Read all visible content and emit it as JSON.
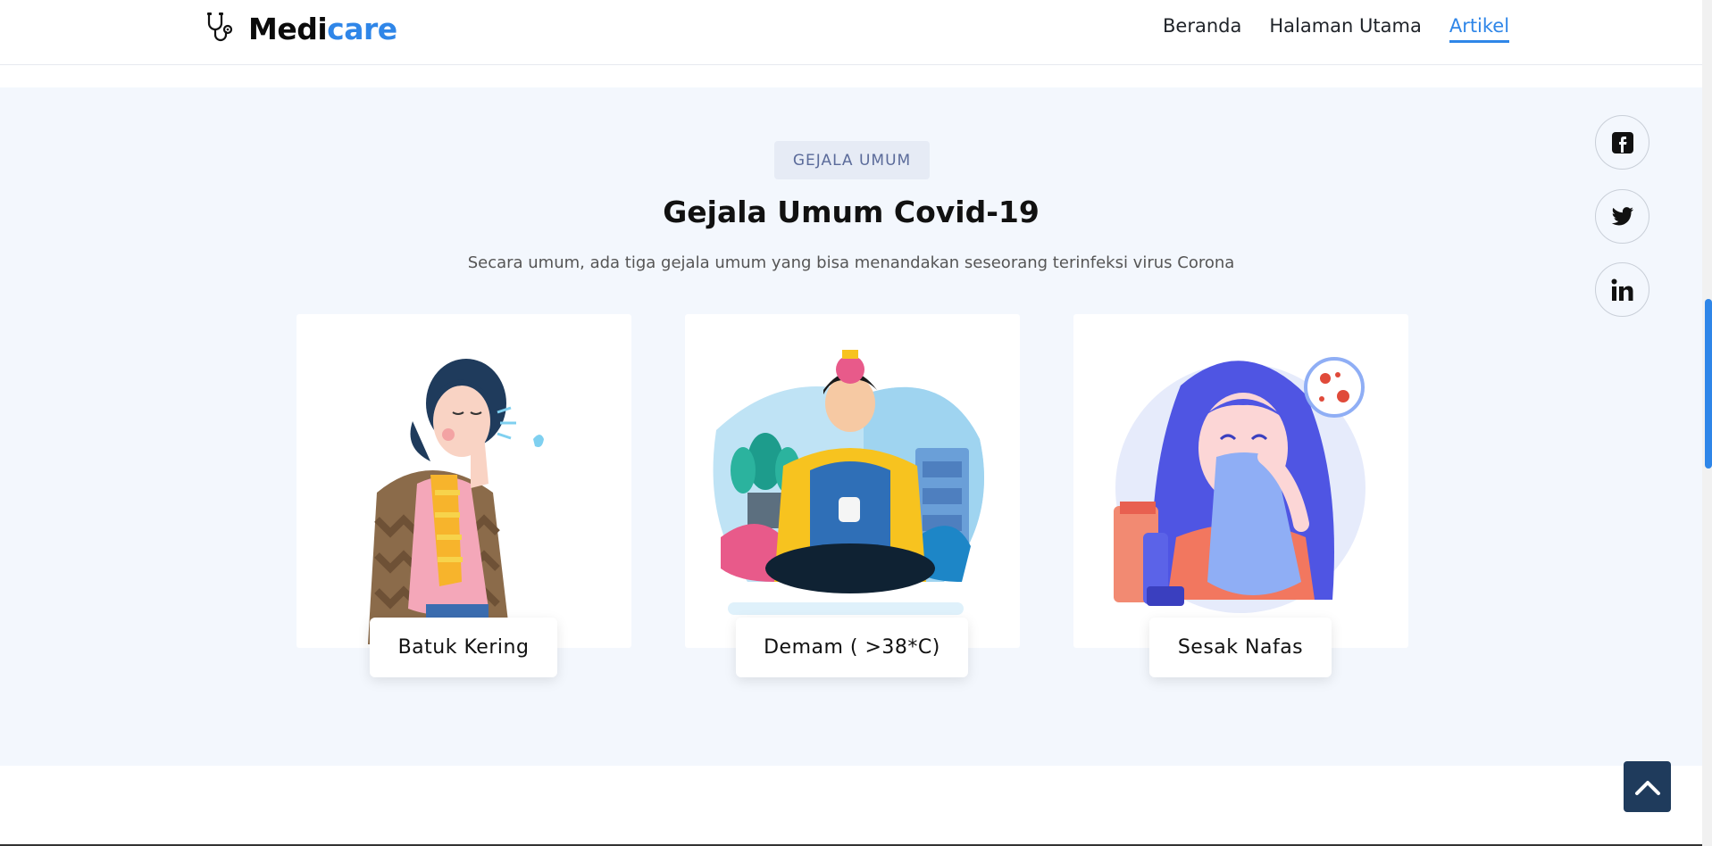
{
  "brand": {
    "part1": "Medi",
    "part2": "care",
    "accent_color": "#2f86e8",
    "icon": "stethoscope-icon"
  },
  "nav": {
    "items": [
      {
        "label": "Beranda",
        "active": false
      },
      {
        "label": "Halaman Utama",
        "active": false
      },
      {
        "label": "Artikel",
        "active": true
      }
    ]
  },
  "section": {
    "tag": "GEJALA UMUM",
    "title": "Gejala Umum Covid-19",
    "subtitle": "Secara umum, ada tiga gejala umum yang bisa menandakan seseorang terinfeksi virus Corona",
    "cards": [
      {
        "label": "Batuk Kering"
      },
      {
        "label": "Demam ( >38*C)"
      },
      {
        "label": "Sesak Nafas"
      }
    ]
  },
  "social": [
    {
      "icon": "facebook-icon"
    },
    {
      "icon": "twitter-icon"
    },
    {
      "icon": "linkedin-icon"
    }
  ],
  "back_to_top": {
    "icon": "chevron-up-icon"
  }
}
